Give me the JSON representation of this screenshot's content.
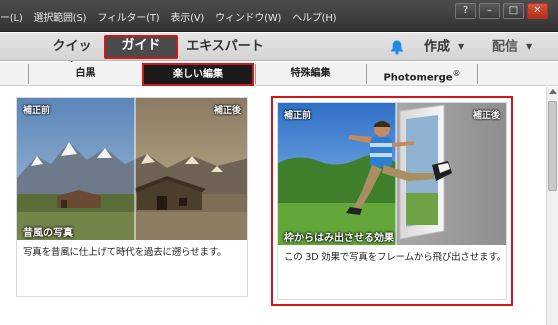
{
  "menubar": {
    "items": [
      "ー(L)",
      "選択範囲(S)",
      "フィルター(T)",
      "表示(V)",
      "ウィンドウ(W)",
      "ヘルプ(H)"
    ],
    "window_controls": [
      "?",
      "–",
      "□",
      "✕"
    ]
  },
  "modes": {
    "quick": "クイック",
    "guide": "ガイド",
    "expert": "エキスパート",
    "create": "作成",
    "share": "配信",
    "active": "guide"
  },
  "subtabs": {
    "items": [
      "白黒",
      "楽しい編集",
      "特殊編集",
      "Photomerge"
    ],
    "photomerge_sup": "®",
    "active_index": 1
  },
  "cards": [
    {
      "before_label": "補正前",
      "after_label": "補正後",
      "title": "昔風の写真",
      "description": "写真を昔風に仕上げて時代を過去に遡らせます。"
    },
    {
      "before_label": "補正前",
      "after_label": "補正後",
      "title": "枠からはみ出させる効果",
      "description": "この 3D 効果で写真をフレームから飛び出させます。"
    }
  ],
  "colors": {
    "highlight": "#d01818",
    "menubar_bg": "#3d3d3d",
    "notification": "#1e88e5"
  }
}
